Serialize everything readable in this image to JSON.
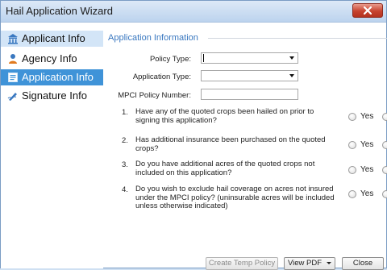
{
  "window": {
    "title": "Hail Application Wizard"
  },
  "sidebar": {
    "items": [
      {
        "label": "Applicant Info",
        "icon": "building-icon",
        "state": "hovered"
      },
      {
        "label": "Agency Info",
        "icon": "person-icon",
        "state": "normal"
      },
      {
        "label": "Application Info",
        "icon": "document-icon",
        "state": "selected"
      },
      {
        "label": "Signature Info",
        "icon": "signature-pen-icon",
        "state": "normal"
      }
    ]
  },
  "section": {
    "title": "Application Information"
  },
  "form": {
    "policy_type_label": "Policy Type:",
    "policy_type_value": "",
    "application_type_label": "Application Type:",
    "application_type_value": "",
    "mpci_label": "MPCI Policy Number:",
    "mpci_value": ""
  },
  "questions": [
    {
      "num": "1.",
      "text": "Have any of the quoted crops been hailed on prior to signing this application?",
      "yes_label": "Yes"
    },
    {
      "num": "2.",
      "text": "Has additional insurance been purchased on the quoted crops?",
      "yes_label": "Yes"
    },
    {
      "num": "3.",
      "text": "Do you have additional acres of the quoted crops not included on this application?",
      "yes_label": "Yes"
    },
    {
      "num": "4.",
      "text": "Do you wish to exclude hail coverage on acres not insured under the MPCI policy? (uninsurable acres will be included unless otherwise indicated)",
      "yes_label": "Yes"
    }
  ],
  "buttons": {
    "create_temp_policy": "Create Temp Policy",
    "view_pdf": "View PDF",
    "close": "Close"
  },
  "colors": {
    "accent": "#3f93d8",
    "section_title": "#3a78c0",
    "close_button": "#c7432f"
  }
}
